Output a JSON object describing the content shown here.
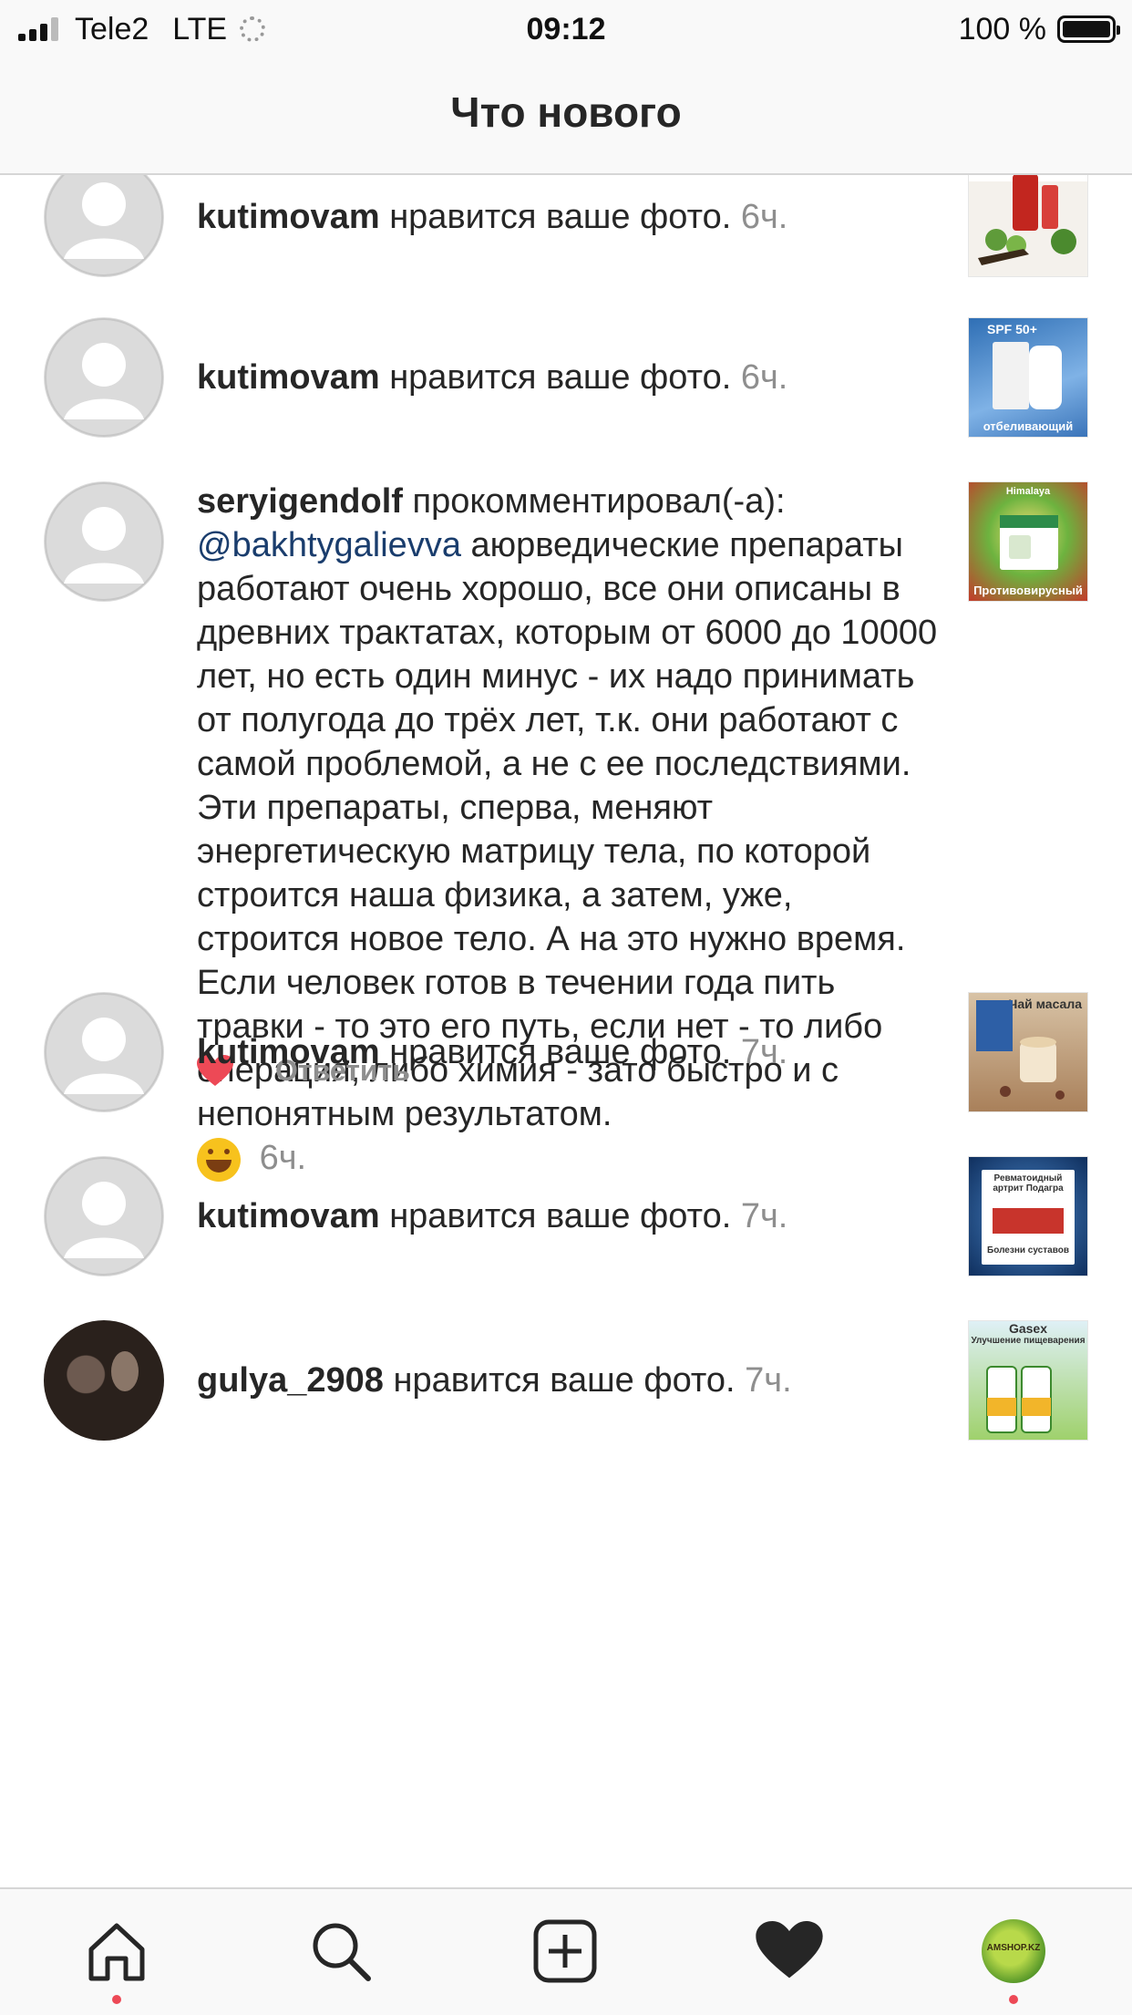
{
  "status_bar": {
    "carrier": "Tele2",
    "network": "LTE",
    "time": "09:12",
    "battery": "100 %"
  },
  "header": {
    "title": "Что нового"
  },
  "feed": {
    "items": [
      {
        "username": "kutimovam",
        "action": "нравится ваше фото.",
        "time": "6ч.",
        "thumb_icon": "herbal-oil-product-thumbnail"
      },
      {
        "username": "kutimovam",
        "action": "нравится ваше фото.",
        "time": "6ч.",
        "thumb_icon": "sunscreen-product-thumbnail",
        "thumb_label": "отбеливающий",
        "thumb_top": "SPF 50+"
      },
      {
        "username": "seryigendolf",
        "action": "прокомментировал(-а):",
        "mention": "@bakhtygalievva",
        "comment": " аюрведические препараты работают очень хорошо, все они описаны в древних трактатах, которым от 6000 до 10000 лет, но есть один минус - их надо принимать от полугода до трёх лет, т.к. они работают с самой проблемой, а не с ее последствиями. Эти препараты, сперва,  меняют энергетическую матрицу тела, по которой строится наша физика, а затем, уже, строится новое тело. А на это нужно время. Если человек готов в течении года пить травки - то это его путь, если нет - то либо операция, либо химия - зато быстро и с непонятным результатом.",
        "time": "6ч.",
        "thumb_label": "Противовирусный",
        "thumb_top": "Himalaya",
        "reply_label": "Ответить"
      },
      {
        "username": "kutimovam",
        "action": "нравится ваше фото.",
        "time": "7ч.",
        "thumb_label": "Чай масала"
      },
      {
        "username": "kutimovam",
        "action": "нравится ваше фото.",
        "time": "7ч.",
        "thumb_top": "Ревматоидный артрит Подагра",
        "thumb_label": "Болезни суставов"
      },
      {
        "username": "gulya_2908",
        "action": "нравится ваше фото.",
        "time": "7ч.",
        "thumb_top": "Gasex",
        "thumb_label": "Улучшение пищеварения"
      }
    ]
  },
  "tab_bar": {
    "tabs": [
      "home-icon",
      "search-icon",
      "new-post-icon",
      "activity-heart-icon",
      "profile-avatar"
    ],
    "profile_text": "AMSHOP.KZ"
  },
  "colors": {
    "accent_red": "#ed4956",
    "mention_blue": "#1a3d6d",
    "secondary_gray": "#8e8e8e"
  }
}
